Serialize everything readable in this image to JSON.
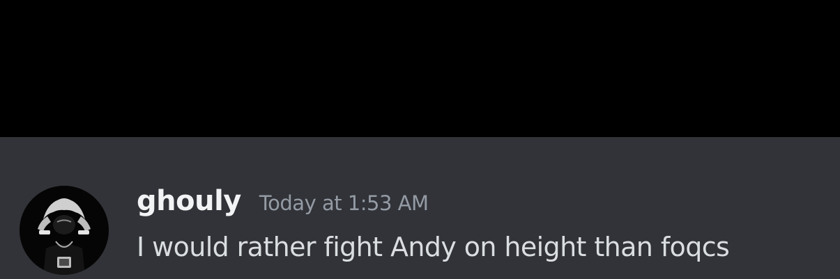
{
  "message": {
    "author": "ghouly",
    "timestamp": "Today at 1:53 AM",
    "content": "I would rather fight Andy on height than foqcs",
    "avatar_icon": "user-avatar-icon"
  },
  "colors": {
    "top_band": "#000000",
    "chat_background": "#313338",
    "username": "#f2f3f5",
    "timestamp": "#949ba4",
    "content": "#dbdee1"
  }
}
